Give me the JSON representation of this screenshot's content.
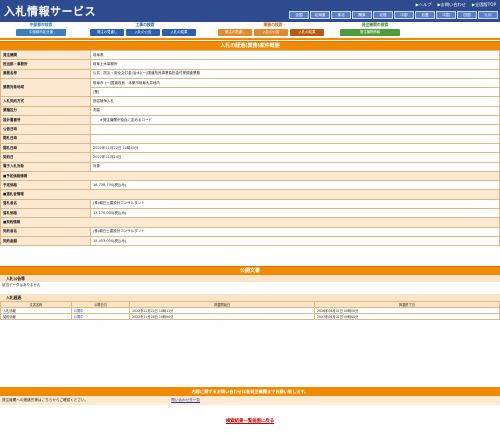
{
  "header": {
    "title": "入札情報サービス",
    "links": [
      "ヘルプ",
      "お問い合わせ",
      "全国版TOP"
    ],
    "regions": [
      "全国",
      "北海道",
      "東北",
      "関東",
      "北陸",
      "中部",
      "近畿",
      "中国",
      "四国",
      "九州"
    ]
  },
  "nav": {
    "groups": [
      {
        "caption": "中部都市検索",
        "color": "#3a7fc1",
        "buttons": [
          {
            "label": "中部都市区分選",
            "color": "#3a7fc1"
          }
        ]
      },
      {
        "caption": "工事の検索",
        "color": "#2d5fb0",
        "buttons": [
          {
            "label": "発注の見通し",
            "color": "#2d5fb0"
          },
          {
            "label": "入札の公告",
            "color": "#2d5fb0"
          },
          {
            "label": "入札の結果",
            "color": "#2d5fb0"
          }
        ]
      },
      {
        "caption": "業務の検索",
        "color": "#d26b18",
        "buttons": [
          {
            "label": "発注の見通し",
            "color": "#e08a2c"
          },
          {
            "label": "入札の公告",
            "color": "#e08a2c"
          },
          {
            "label": "入札の結果",
            "color": "#b85a10"
          }
        ]
      },
      {
        "caption": "発注機関の検索",
        "color": "#3a8a2c",
        "buttons": [
          {
            "label": "発注機関情報",
            "color": "#4d9e3a"
          }
        ]
      }
    ]
  },
  "detail": {
    "title": "入札の経過(業務)案件概要",
    "rows": [
      {
        "key": "発注機関",
        "value": "岐阜県"
      },
      {
        "key": "担当部・事務所",
        "value": "岐阜土木事務所"
      },
      {
        "key": "業務名称",
        "value": "公共　防災・安全交付金(治水)(一)国道改良事業負担金付帯調査業務"
      },
      {
        "key": "業務対象地域",
        "value": "岐阜市 (一)国道改良　本巣市岐阜大井地内"
      },
      {
        "key": "",
        "value": "(業)"
      },
      {
        "key": "入札契約方式",
        "value": "指名競争入札"
      },
      {
        "key": "業種区分",
        "value": "測量"
      },
      {
        "key": "設計書番号",
        "value": "　　※発注機関が独自に定めるコード"
      },
      {
        "key": "公告日時",
        "value": ""
      },
      {
        "key": "開札日時",
        "value": ""
      },
      {
        "key": "開札日時",
        "value": "2022年11月22日 10時55分"
      },
      {
        "key": "契約日",
        "value": "2022年11月24日"
      },
      {
        "key": "電子入札対象",
        "value": "対象"
      }
    ],
    "price_section": "予定価格情報",
    "price_rows": [
      {
        "key": "予定価格",
        "value": "16,738,700(税込み)"
      }
    ],
    "low_section": "落札者情報",
    "low_rows": [
      {
        "key": "落札者名",
        "value": "(株)朝日土建設計コンサルタント"
      },
      {
        "key": "落札価格",
        "value": "13,170,000(税込み)"
      }
    ],
    "contract_section": "契約情報",
    "contract_rows": [
      {
        "key": "契約者名",
        "value": "(株)朝日土建設計コンサルタント"
      },
      {
        "key": "契約金額",
        "value": "15,453,000(税込み)"
      }
    ]
  },
  "docs": {
    "title": "公開文書",
    "notice_head": "入札公告等",
    "notice_empty": "該当データはありません",
    "history_head": "入札経過",
    "columns": [
      "文書名称",
      "公開日付",
      "掲載開始日",
      "掲載終了日"
    ],
    "rows": [
      {
        "name": "入札情報",
        "link": "公開中",
        "start": "2022年11月22日 10時11分",
        "end": "2026年04月01日 00時00分"
      },
      {
        "name": "契約情報",
        "link": "公開中",
        "start": "2022年11月28日 10時00分",
        "end": "2027年04月01日 00時00分"
      }
    ]
  },
  "inquiry": {
    "bar": "内容に関するお問い合わせは各発注機関までお願い致します。",
    "text": "発注機関への連絡先等はこちらからご確認ください。",
    "link": "問い合わせ先一覧"
  },
  "back": "検索結果一覧画面に戻る"
}
